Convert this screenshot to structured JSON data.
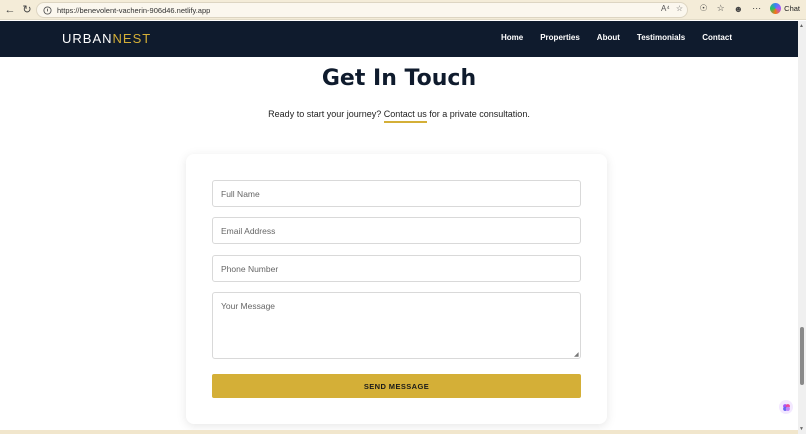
{
  "browser": {
    "url": "https://benevolent-vacherin-906d46.netlify.app",
    "read_aloud_icon": "A⁴",
    "chat_label": "Chat"
  },
  "site": {
    "logo_part1": "URBAN",
    "logo_part2": "NEST",
    "brand_color": "#d4af37",
    "nav_bg": "#0f1b2d",
    "nav_items": [
      "Home",
      "Properties",
      "About",
      "Testimonials",
      "Contact"
    ]
  },
  "contact": {
    "title": "Get In Touch",
    "subtitle_before": "Ready to start your journey? ",
    "subtitle_link": "Contact us",
    "subtitle_after": " for a private consultation.",
    "full_name_placeholder": "Full Name",
    "email_placeholder": "Email Address",
    "phone_placeholder": "Phone Number",
    "message_placeholder": "Your Message",
    "send_label": "SEND MESSAGE"
  }
}
